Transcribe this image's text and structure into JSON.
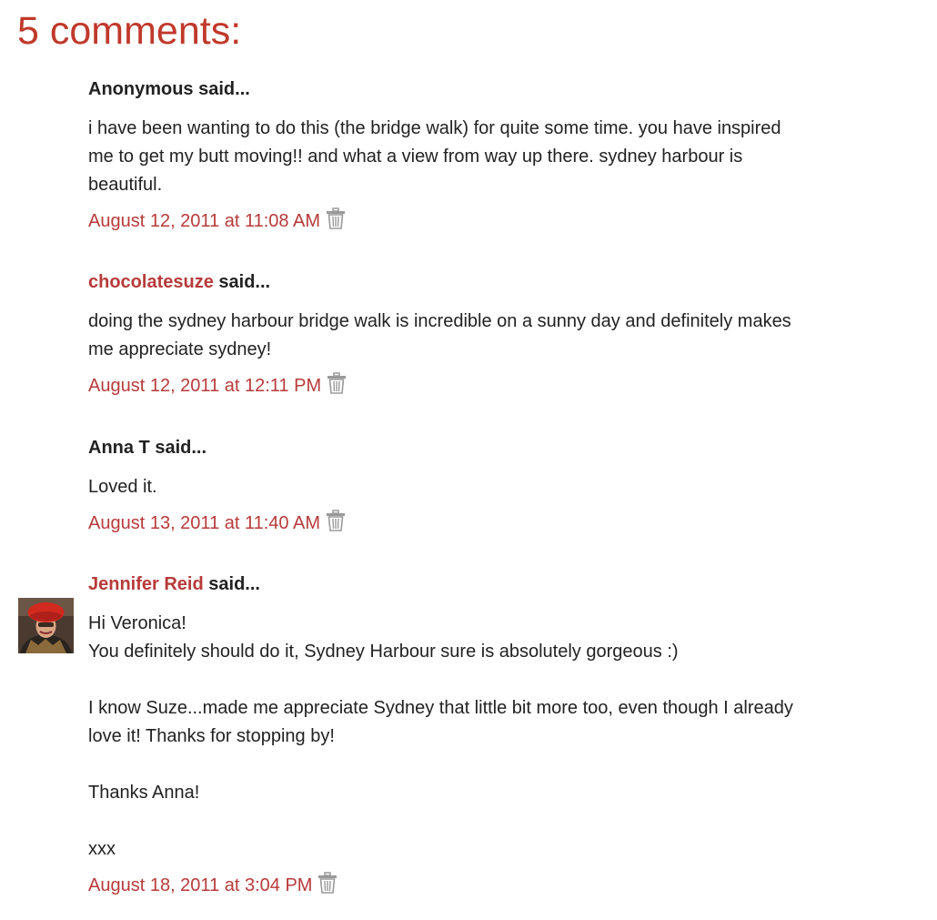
{
  "heading": "5 comments:",
  "said_suffix": "said...",
  "comments": [
    {
      "author": "Anonymous",
      "author_is_link": false,
      "body": "i have been wanting to do this (the bridge walk) for quite some time. you have inspired\nme to get my butt moving!! and what a view from way up there. sydney harbour is\nbeautiful.",
      "timestamp": "August 12, 2011 at 11:08 AM"
    },
    {
      "author": "chocolatesuze",
      "author_is_link": true,
      "body": "doing the sydney harbour bridge walk is incredible on a sunny day and definitely makes\nme appreciate sydney!",
      "timestamp": "August 12, 2011 at 12:11 PM"
    },
    {
      "author": "Anna T",
      "author_is_link": false,
      "body": "Loved it.",
      "timestamp": "August 13, 2011 at 11:40 AM"
    },
    {
      "author": "Jennifer Reid",
      "author_is_link": true,
      "has_avatar": true,
      "body": "Hi Veronica!\nYou definitely should do it, Sydney Harbour sure is absolutely gorgeous :)\n\nI know Suze...made me appreciate Sydney that little bit more too, even though I already\nlove it! Thanks for stopping by!\n\nThanks Anna!\n\nxxx",
      "timestamp": "August 18, 2011 at 3:04 PM"
    }
  ],
  "colors": {
    "accent": "#c0392b",
    "link": "#b83a3a",
    "text": "#222222",
    "icon": "#9a9a9a"
  },
  "icons": {
    "delete": "trash-icon"
  }
}
